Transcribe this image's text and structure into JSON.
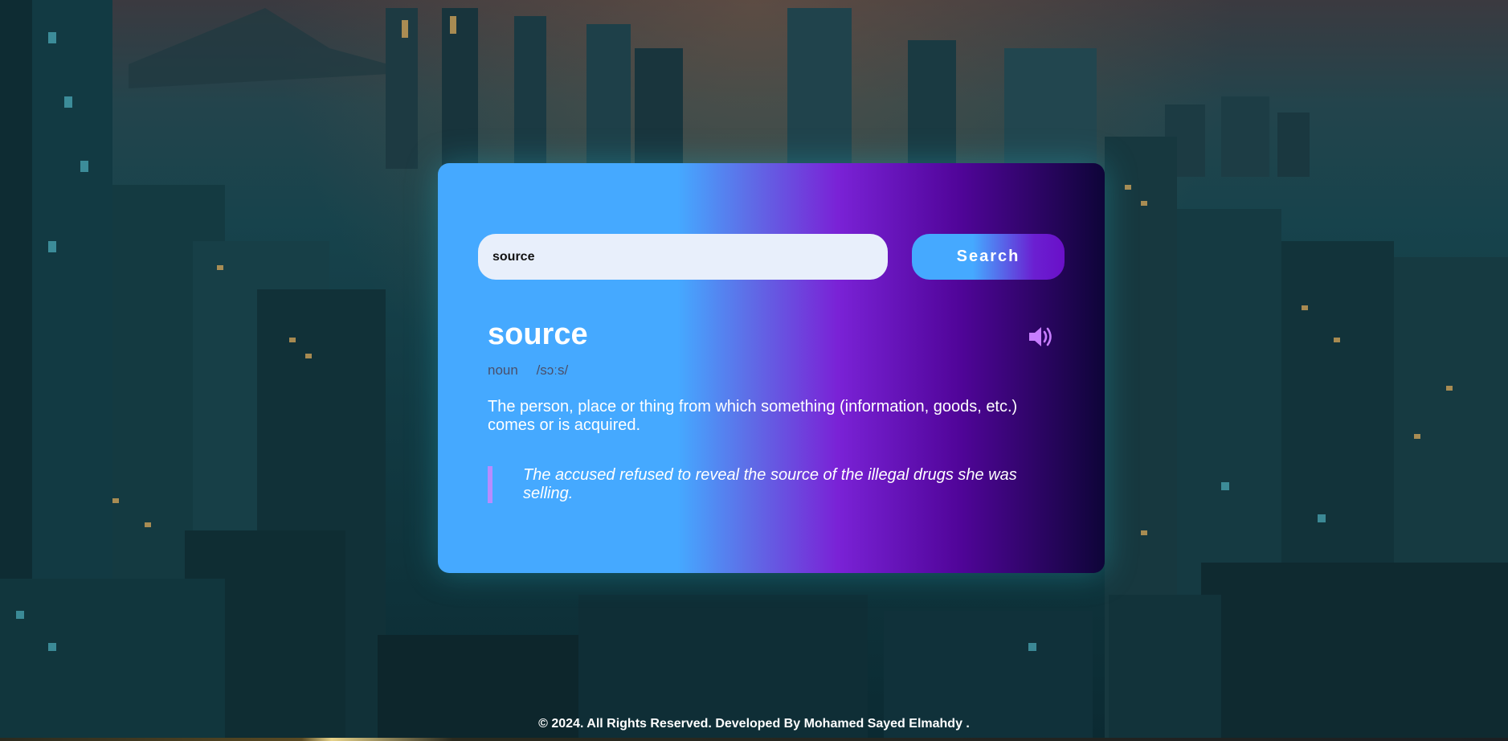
{
  "search": {
    "value": "source",
    "button_label": "Search"
  },
  "result": {
    "word": "source",
    "part_of_speech": "noun",
    "phonetic": "/sɔːs/",
    "definition": "The person, place or thing from which something (information, goods, etc.) comes or is acquired.",
    "example": "The accused refused to reveal the source of the illegal drugs she was selling.",
    "audio_icon": "speaker-volume-icon"
  },
  "footer": {
    "text": "© 2024. All Rights Reserved. Developed By Mohamed Sayed Elmahdy ."
  },
  "colors": {
    "accent_blue": "#45a9ff",
    "accent_purple": "#7a22d6",
    "speaker": "#c77dff",
    "quote_border": "#b78cff"
  }
}
